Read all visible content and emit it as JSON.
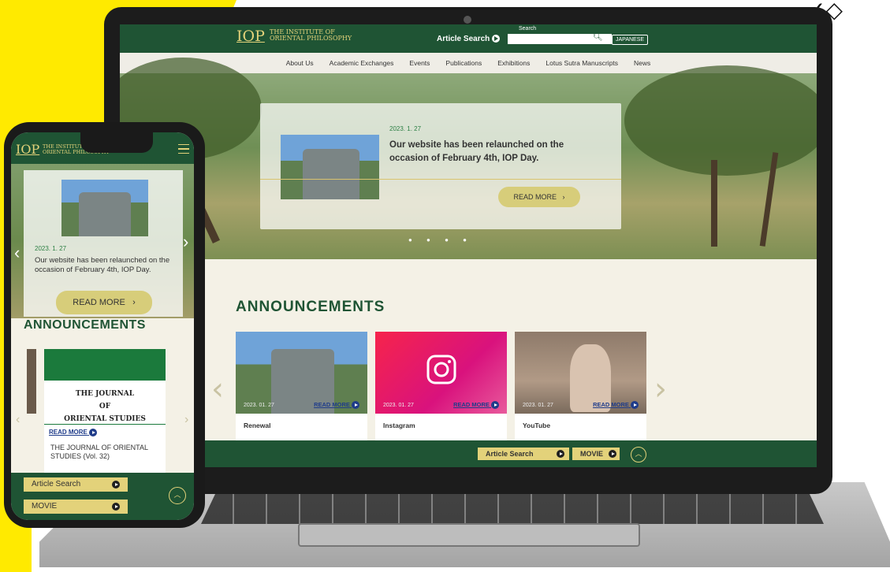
{
  "corner_mark": "✓◇",
  "site": {
    "logo_mark": "IOP",
    "logo_line1": "THE INSTITUTE OF",
    "logo_line2": "ORIENTAL PHILOSOPHY"
  },
  "header": {
    "article_search_label": "Article Search",
    "search_label": "Search",
    "search_placeholder": "",
    "japanese_label": "JAPANESE"
  },
  "nav": {
    "items": [
      "About Us",
      "Academic Exchanges",
      "Events",
      "Publications",
      "Exhibitions",
      "Lotus Sutra Manuscripts",
      "News"
    ]
  },
  "hero": {
    "date": "2023. 1. 27",
    "title": "Our website has been relaunched on the occasion of February 4th, IOP Day.",
    "read_more": "READ MORE",
    "chevron": "›"
  },
  "announcements": {
    "title": "ANNOUNCEMENTS",
    "items": [
      {
        "date": "2023. 01. 27",
        "more": "READ MORE",
        "label": "Renewal"
      },
      {
        "date": "2023. 01. 27",
        "more": "READ MORE",
        "label": "Instagram"
      },
      {
        "date": "2023. 01. 27",
        "more": "READ MORE",
        "label": "YouTube"
      }
    ]
  },
  "footer": {
    "article_search": "Article Search",
    "movie": "MOVIE",
    "up": "︿"
  },
  "phone": {
    "date": "2023. 1. 27",
    "title": "Our website has been relaunched on the occasion of February 4th, IOP Day.",
    "read_more": "READ MORE",
    "chevron": "›",
    "ann_title": "ANNOUNCEMENTS",
    "journal_line1": "THE JOURNAL",
    "journal_line2": "OF",
    "journal_line3": "ORIENTAL STUDIES",
    "journal_more": "READ MORE",
    "journal_label": "THE JOURNAL OF ORIENTAL STUDIES (Vol. 32)",
    "article_search": "Article Search",
    "movie": "MOVIE",
    "up": "︿"
  },
  "colors": {
    "brand_green": "#1f5434",
    "accent_gold": "#e3d27a",
    "background_yellow": "#ffea00"
  }
}
